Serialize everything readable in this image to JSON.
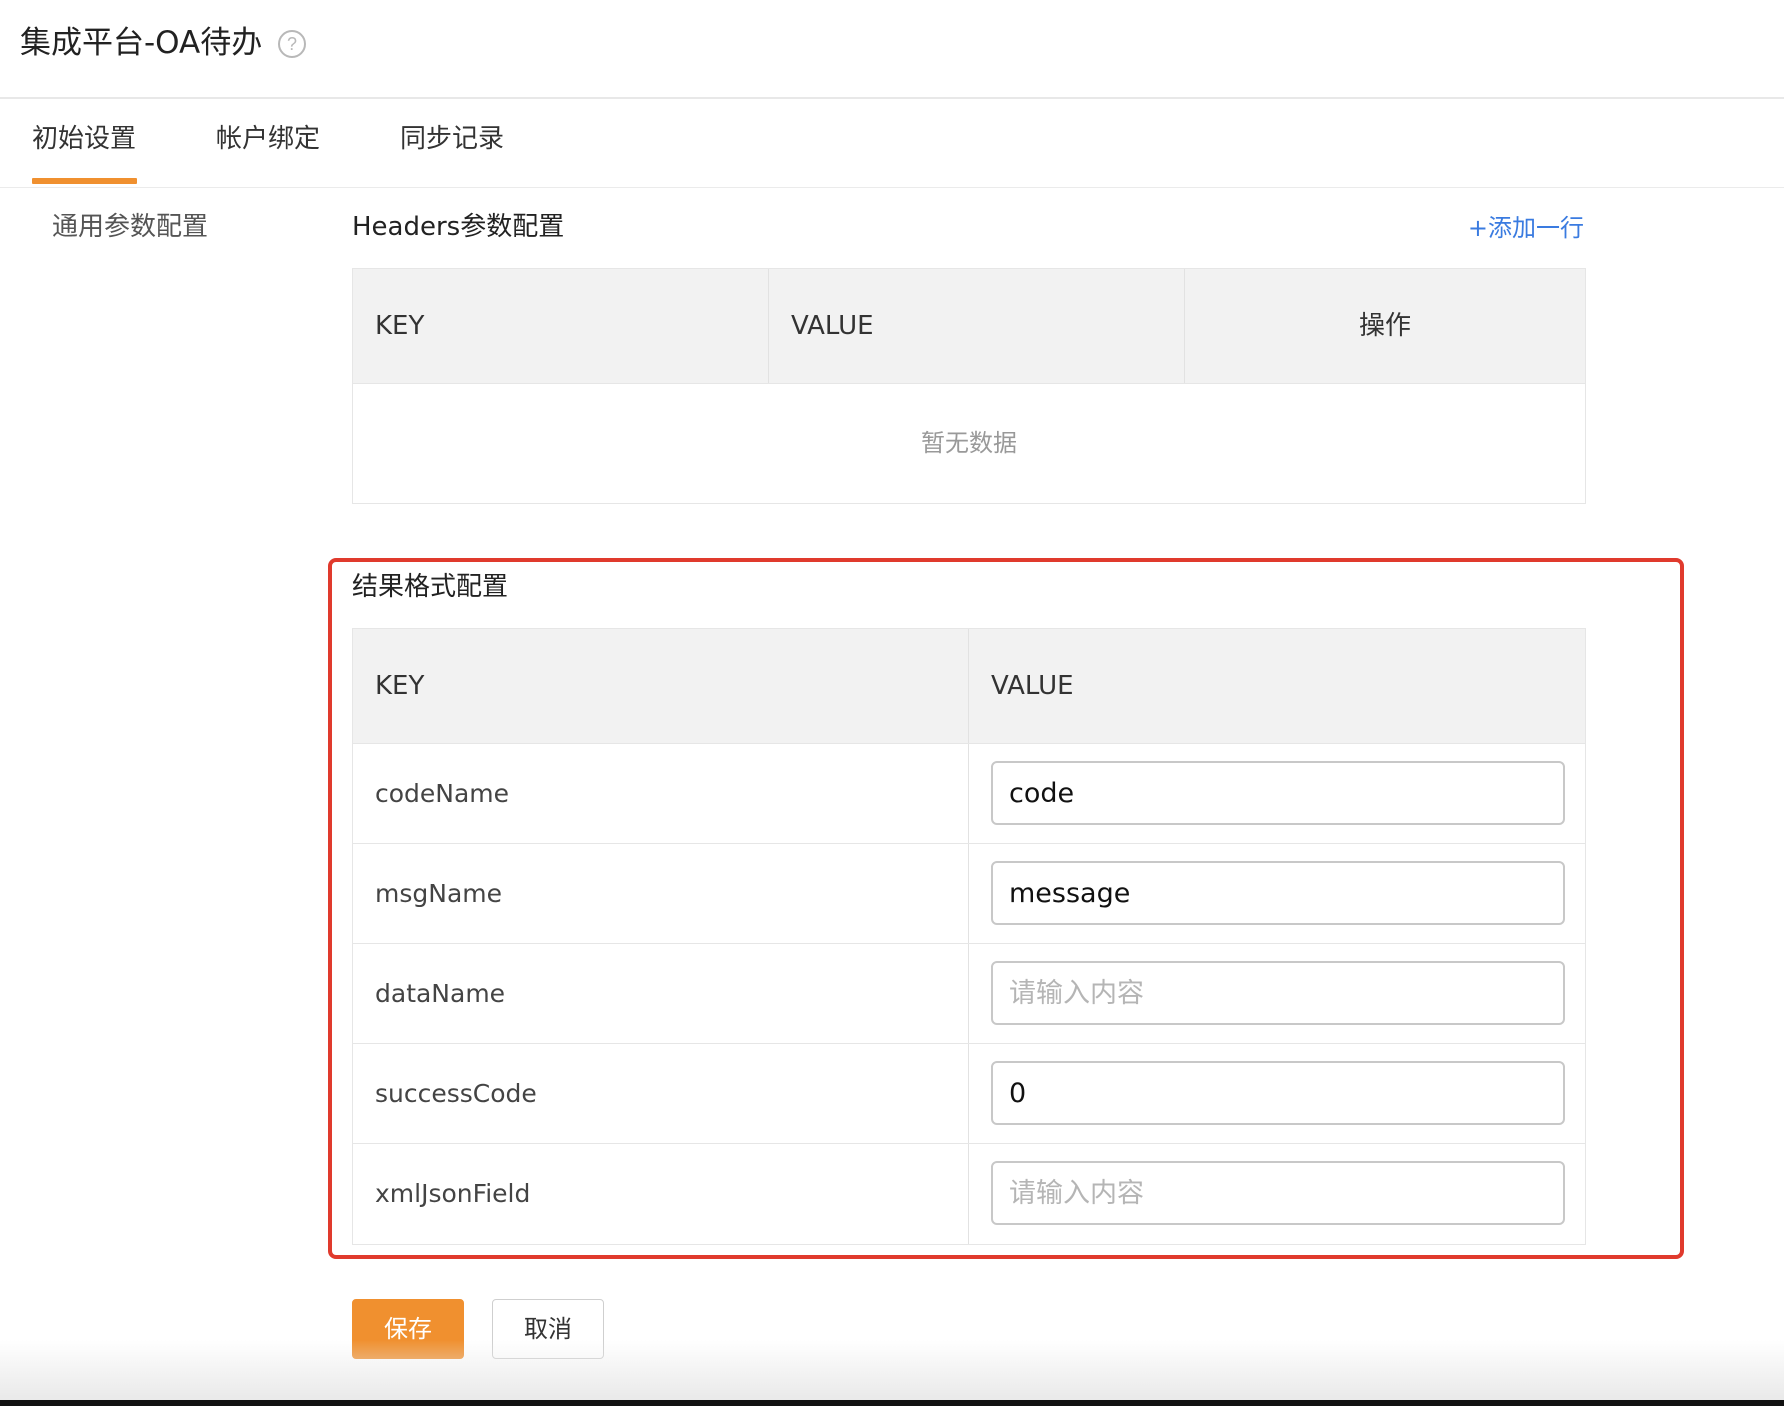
{
  "header": {
    "title": "集成平台-OA待办",
    "help_icon": "?"
  },
  "tabs": [
    {
      "label": "初始设置",
      "active": true
    },
    {
      "label": "帐户绑定",
      "active": false
    },
    {
      "label": "同步记录",
      "active": false
    }
  ],
  "sidebar": {
    "items": [
      {
        "label": "通用参数配置"
      }
    ]
  },
  "headers_section": {
    "title": "Headers参数配置",
    "add_row_label": "+添加一行",
    "columns": [
      "KEY",
      "VALUE",
      "操作"
    ],
    "empty_text": "暂无数据"
  },
  "result_section": {
    "title": "结果格式配置",
    "columns": [
      "KEY",
      "VALUE"
    ],
    "rows": [
      {
        "key": "codeName",
        "value": "code",
        "placeholder": "请输入内容"
      },
      {
        "key": "msgName",
        "value": "message",
        "placeholder": "请输入内容"
      },
      {
        "key": "dataName",
        "value": "",
        "placeholder": "请输入内容"
      },
      {
        "key": "successCode",
        "value": "0",
        "placeholder": "请输入内容"
      },
      {
        "key": "xmlJsonField",
        "value": "",
        "placeholder": "请输入内容"
      }
    ]
  },
  "actions": {
    "save_label": "保存",
    "cancel_label": "取消"
  },
  "colors": {
    "accent": "#f0902f",
    "link": "#3a7be0",
    "highlight_border": "#e03a2d"
  }
}
